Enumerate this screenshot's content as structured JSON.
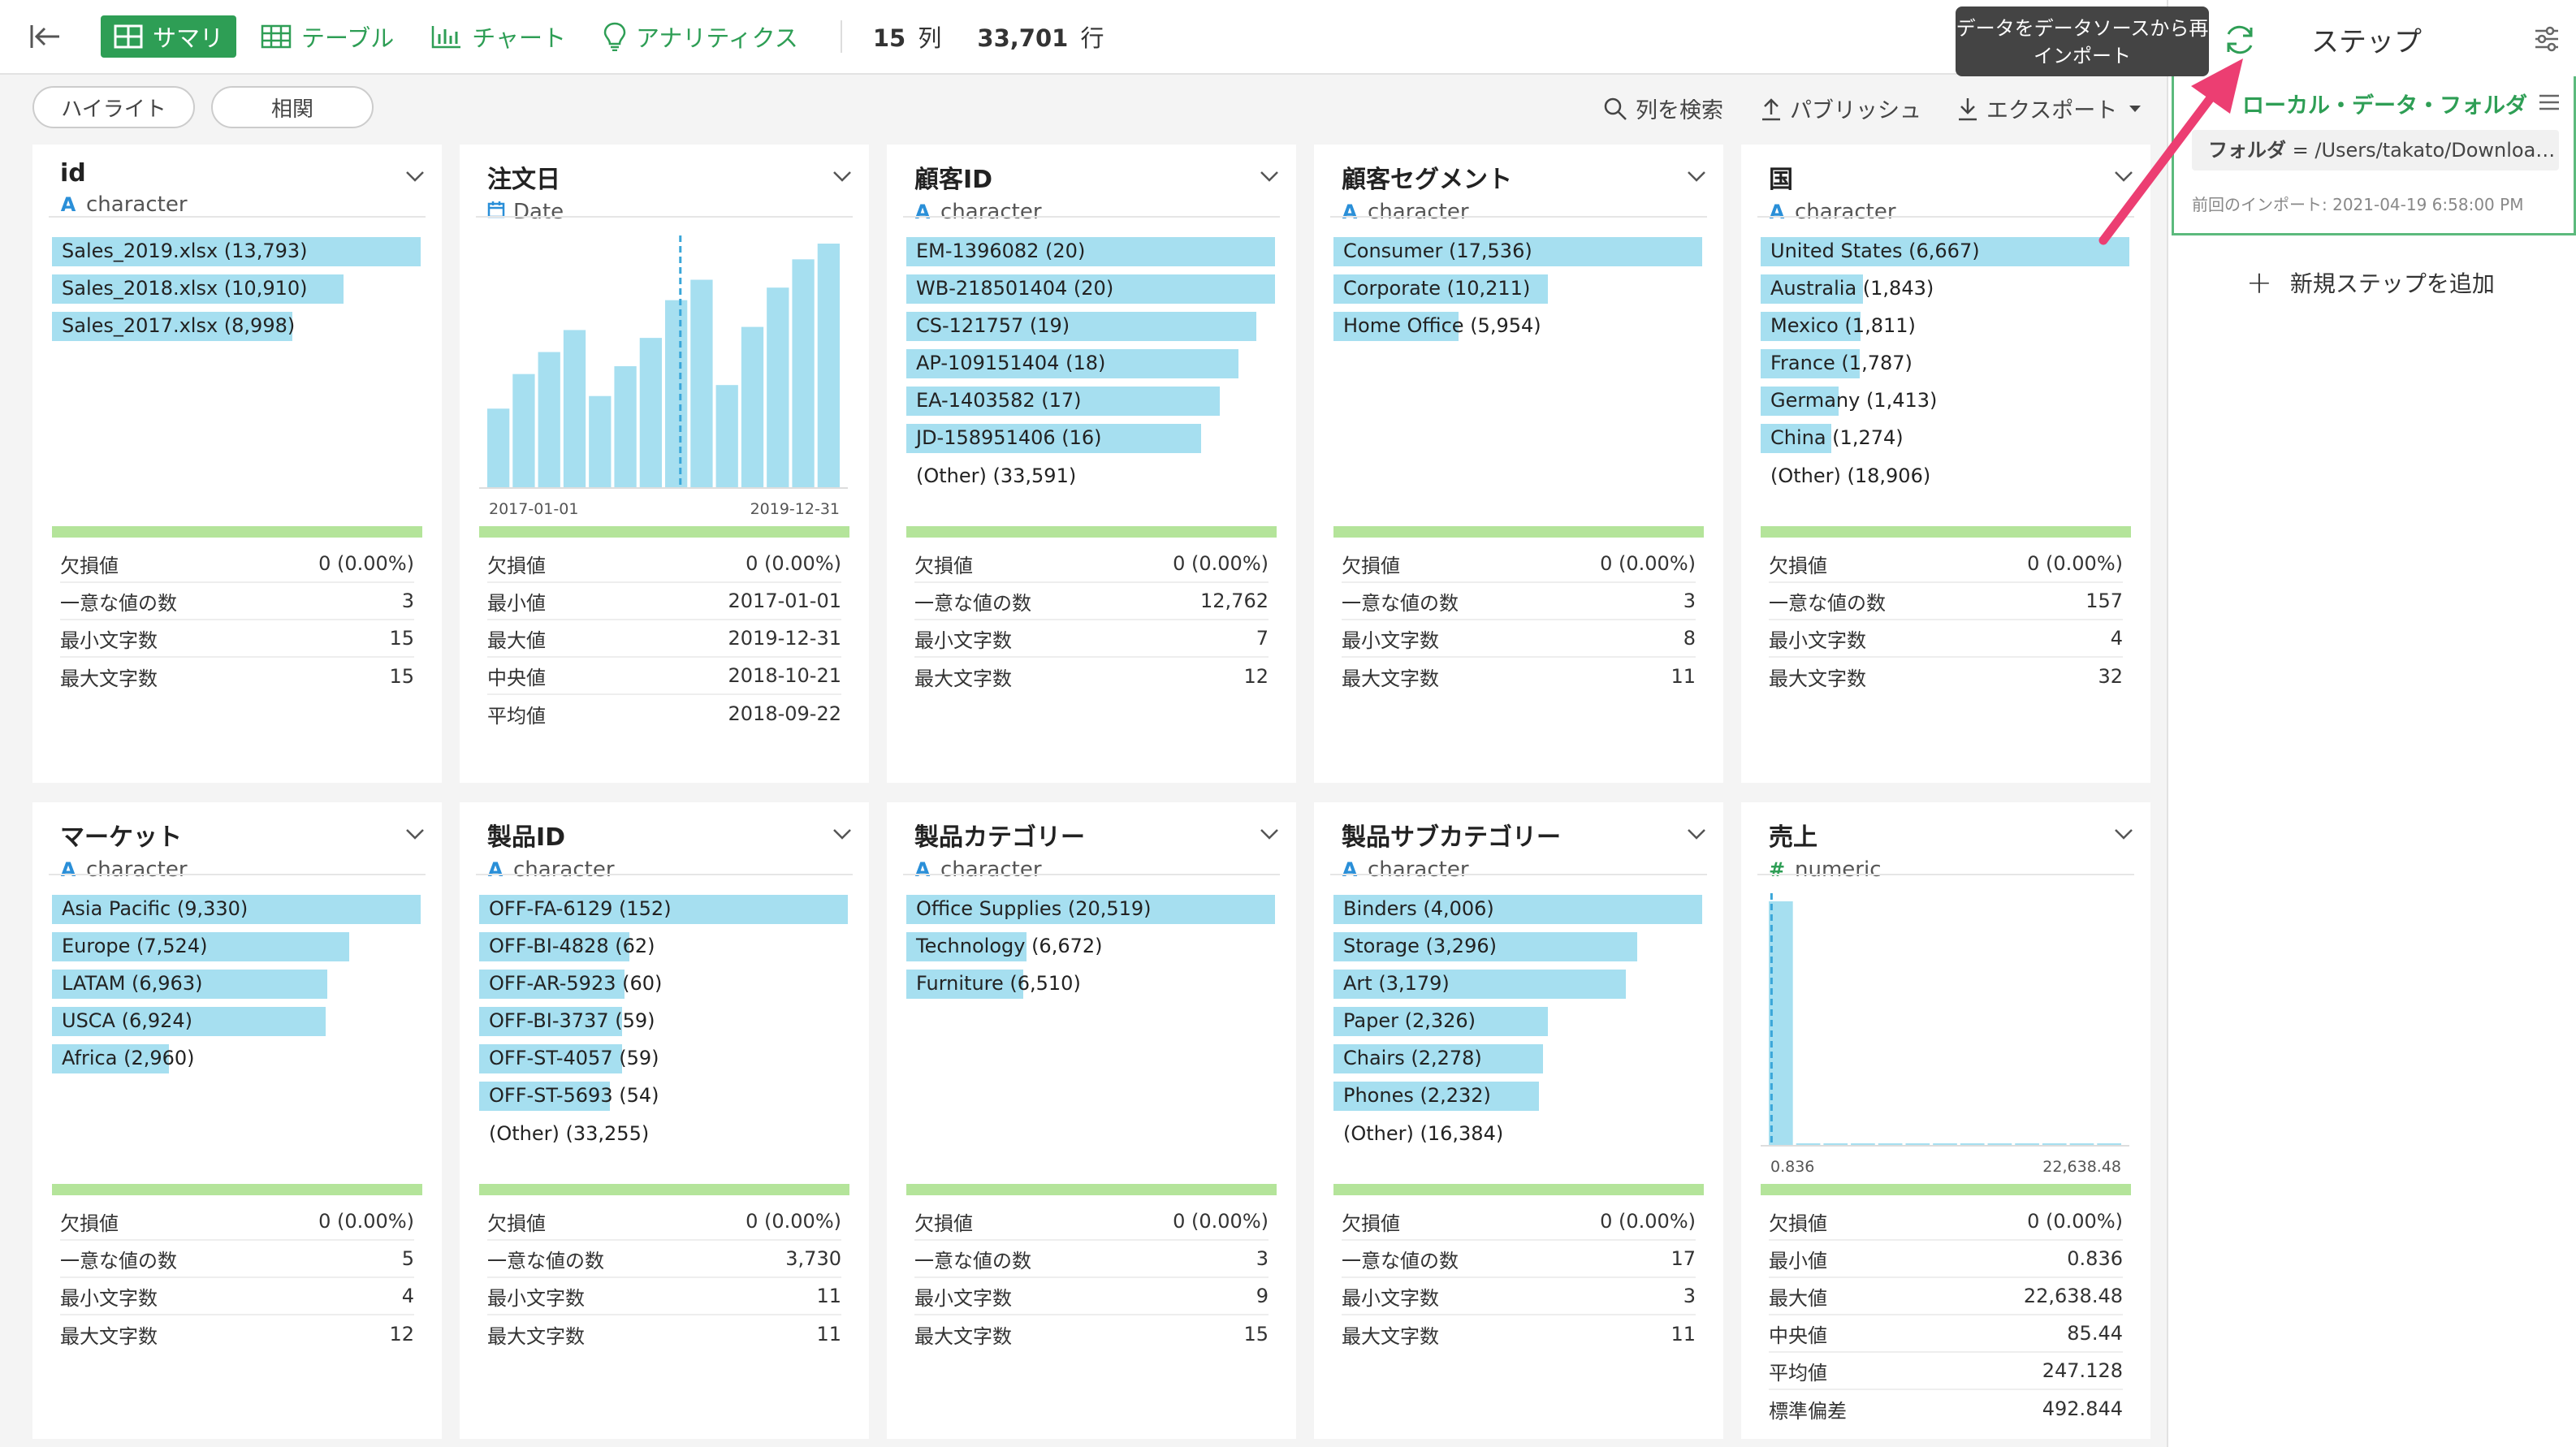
{
  "toolbar": {
    "tabs": [
      {
        "label": "サマリ",
        "icon": "summary-icon",
        "active": true
      },
      {
        "label": "テーブル",
        "icon": "table-icon"
      },
      {
        "label": "チャート",
        "icon": "chart-icon"
      },
      {
        "label": "アナリティクス",
        "icon": "bulb-icon"
      }
    ],
    "cols_value": "15",
    "cols_unit": "列",
    "rows_value": "33,701",
    "rows_unit": "行",
    "tooltip": "データをデータソースから再インポート",
    "steps_label": "ステップ"
  },
  "subbar": {
    "highlight_label": "ハイライト",
    "correlation_label": "相関",
    "search_label": "列を検索",
    "publish_label": "パブリッシュ",
    "export_label": "エクスポート"
  },
  "cards": [
    {
      "title": "id",
      "type": "character",
      "type_icon": "A",
      "bars": [
        {
          "label": "Sales_2019.xlsx (13,793)",
          "value": 13793
        },
        {
          "label": "Sales_2018.xlsx (10,910)",
          "value": 10910
        },
        {
          "label": "Sales_2017.xlsx (8,998)",
          "value": 8998
        }
      ],
      "bar_max": 13793,
      "stats": [
        {
          "label": "欠損値",
          "value": "0 (0.00%)"
        },
        {
          "label": "一意な値の数",
          "value": "3"
        },
        {
          "label": "最小文字数",
          "value": "15"
        },
        {
          "label": "最大文字数",
          "value": "15"
        }
      ]
    },
    {
      "title": "注文日",
      "type": "Date",
      "type_icon": "calendar",
      "hist": {
        "values": [
          50,
          72,
          86,
          100,
          58,
          77,
          95,
          119,
          132,
          65,
          102,
          127,
          145,
          155
        ],
        "x_min": "2017-01-01",
        "x_max": "2019-12-31",
        "marker_index": 7.6
      },
      "stats": [
        {
          "label": "欠損値",
          "value": "0 (0.00%)"
        },
        {
          "label": "最小値",
          "value": "2017-01-01"
        },
        {
          "label": "最大値",
          "value": "2019-12-31"
        },
        {
          "label": "中央値",
          "value": "2018-10-21"
        },
        {
          "label": "平均値",
          "value": "2018-09-22"
        }
      ]
    },
    {
      "title": "顧客ID",
      "type": "character",
      "type_icon": "A",
      "bars": [
        {
          "label": "EM-1396082 (20)",
          "value": 20
        },
        {
          "label": "WB-218501404 (20)",
          "value": 20
        },
        {
          "label": "CS-121757 (19)",
          "value": 19
        },
        {
          "label": "AP-109151404 (18)",
          "value": 18
        },
        {
          "label": "EA-1403582 (17)",
          "value": 17
        },
        {
          "label": "JD-158951406 (16)",
          "value": 16
        }
      ],
      "bar_max": 20,
      "other": "(Other) (33,591)",
      "stats": [
        {
          "label": "欠損値",
          "value": "0 (0.00%)"
        },
        {
          "label": "一意な値の数",
          "value": "12,762"
        },
        {
          "label": "最小文字数",
          "value": "7"
        },
        {
          "label": "最大文字数",
          "value": "12"
        }
      ]
    },
    {
      "title": "顧客セグメント",
      "type": "character",
      "type_icon": "A",
      "bars": [
        {
          "label": "Consumer (17,536)",
          "value": 17536
        },
        {
          "label": "Corporate (10,211)",
          "value": 10211
        },
        {
          "label": "Home Office (5,954)",
          "value": 5954
        }
      ],
      "bar_max": 17536,
      "stats": [
        {
          "label": "欠損値",
          "value": "0 (0.00%)"
        },
        {
          "label": "一意な値の数",
          "value": "3"
        },
        {
          "label": "最小文字数",
          "value": "8"
        },
        {
          "label": "最大文字数",
          "value": "11"
        }
      ]
    },
    {
      "title": "国",
      "type": "character",
      "type_icon": "A",
      "bars": [
        {
          "label": "United States (6,667)",
          "value": 6667
        },
        {
          "label": "Australia (1,843)",
          "value": 1843
        },
        {
          "label": "Mexico (1,811)",
          "value": 1811
        },
        {
          "label": "France (1,787)",
          "value": 1787
        },
        {
          "label": "Germany (1,413)",
          "value": 1413
        },
        {
          "label": "China (1,274)",
          "value": 1274
        }
      ],
      "bar_max": 6667,
      "other": "(Other) (18,906)",
      "stats": [
        {
          "label": "欠損値",
          "value": "0 (0.00%)"
        },
        {
          "label": "一意な値の数",
          "value": "157"
        },
        {
          "label": "最小文字数",
          "value": "4"
        },
        {
          "label": "最大文字数",
          "value": "32"
        }
      ]
    },
    {
      "title": "マーケット",
      "type": "character",
      "type_icon": "A",
      "bars": [
        {
          "label": "Asia Pacific (9,330)",
          "value": 9330
        },
        {
          "label": "Europe (7,524)",
          "value": 7524
        },
        {
          "label": "LATAM (6,963)",
          "value": 6963
        },
        {
          "label": "USCA (6,924)",
          "value": 6924
        },
        {
          "label": "Africa (2,960)",
          "value": 2960
        }
      ],
      "bar_max": 9330,
      "stats": [
        {
          "label": "欠損値",
          "value": "0 (0.00%)"
        },
        {
          "label": "一意な値の数",
          "value": "5"
        },
        {
          "label": "最小文字数",
          "value": "4"
        },
        {
          "label": "最大文字数",
          "value": "12"
        }
      ]
    },
    {
      "title": "製品ID",
      "type": "character",
      "type_icon": "A",
      "bars": [
        {
          "label": "OFF-FA-6129 (152)",
          "value": 152
        },
        {
          "label": "OFF-BI-4828 (62)",
          "value": 62
        },
        {
          "label": "OFF-AR-5923 (60)",
          "value": 60
        },
        {
          "label": "OFF-BI-3737 (59)",
          "value": 59
        },
        {
          "label": "OFF-ST-4057 (59)",
          "value": 59
        },
        {
          "label": "OFF-ST-5693 (54)",
          "value": 54
        }
      ],
      "bar_max": 152,
      "other": "(Other) (33,255)",
      "stats": [
        {
          "label": "欠損値",
          "value": "0 (0.00%)"
        },
        {
          "label": "一意な値の数",
          "value": "3,730"
        },
        {
          "label": "最小文字数",
          "value": "11"
        },
        {
          "label": "最大文字数",
          "value": "11"
        }
      ]
    },
    {
      "title": "製品カテゴリー",
      "type": "character",
      "type_icon": "A",
      "bars": [
        {
          "label": "Office Supplies (20,519)",
          "value": 20519
        },
        {
          "label": "Technology (6,672)",
          "value": 6672
        },
        {
          "label": "Furniture (6,510)",
          "value": 6510
        }
      ],
      "bar_max": 20519,
      "stats": [
        {
          "label": "欠損値",
          "value": "0 (0.00%)"
        },
        {
          "label": "一意な値の数",
          "value": "3"
        },
        {
          "label": "最小文字数",
          "value": "9"
        },
        {
          "label": "最大文字数",
          "value": "15"
        }
      ]
    },
    {
      "title": "製品サブカテゴリー",
      "type": "character",
      "type_icon": "A",
      "bars": [
        {
          "label": "Binders (4,006)",
          "value": 4006
        },
        {
          "label": "Storage (3,296)",
          "value": 3296
        },
        {
          "label": "Art (3,179)",
          "value": 3179
        },
        {
          "label": "Paper (2,326)",
          "value": 2326
        },
        {
          "label": "Chairs (2,278)",
          "value": 2278
        },
        {
          "label": "Phones (2,232)",
          "value": 2232
        }
      ],
      "bar_max": 4006,
      "other": "(Other) (16,384)",
      "stats": [
        {
          "label": "欠損値",
          "value": "0 (0.00%)"
        },
        {
          "label": "一意な値の数",
          "value": "17"
        },
        {
          "label": "最小文字数",
          "value": "3"
        },
        {
          "label": "最大文字数",
          "value": "11"
        }
      ]
    },
    {
      "title": "売上",
      "type": "numeric",
      "type_icon": "#",
      "hist": {
        "values": [
          155,
          1,
          1,
          1,
          1,
          0.5,
          0.5,
          0.3,
          0.3,
          0.2,
          0.2,
          0.5,
          0.3
        ],
        "x_min": "0.836",
        "x_max": "22,638.48",
        "marker_index": 0.1
      },
      "stats": [
        {
          "label": "欠損値",
          "value": "0 (0.00%)"
        },
        {
          "label": "最小値",
          "value": "0.836"
        },
        {
          "label": "最大値",
          "value": "22,638.48"
        },
        {
          "label": "中央値",
          "value": "85.44"
        },
        {
          "label": "平均値",
          "value": "247.128"
        },
        {
          "label": "標準偏差",
          "value": "492.844"
        }
      ]
    }
  ],
  "steps": {
    "step_title": "ローカル・データ・フォルダ",
    "folder_label": "フォルダ",
    "folder_value": "= /Users/takato/Downloa…",
    "last_import": "前回のインポート: 2021-04-19 6:58:00 PM",
    "add_step": "新規ステップを追加"
  },
  "colors": {
    "accent": "#2e9e55",
    "bar": "#a6dff0",
    "quality": "#b4e49a",
    "arrow": "#ec3e72"
  }
}
